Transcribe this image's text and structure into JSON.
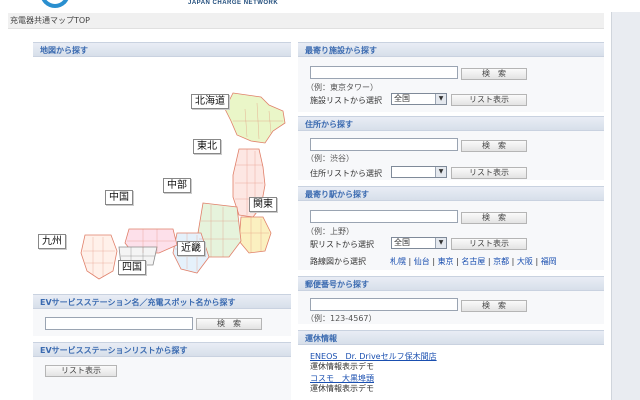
{
  "header": {
    "logo_text": "JAPAN CHARGE NETWORK",
    "breadcrumb": "充電器共通マップTOP"
  },
  "map_search": {
    "title": "地図から探す",
    "regions": [
      "北海道",
      "東北",
      "中部",
      "関東",
      "中国",
      "九州",
      "近畿",
      "四国"
    ]
  },
  "station_name_search": {
    "title": "EVサービスステーション名／充電スポット名から探す",
    "search_label": "検　索"
  },
  "station_list_search": {
    "title": "EVサービスステーションリストから探す",
    "list_label": "リスト表示"
  },
  "nearest_facility": {
    "title": "最寄り施設から探す",
    "search_label": "検　索",
    "example": "（例：東京タワー）",
    "list_select_label": "施設リストから選択",
    "select_value": "全国",
    "list_label": "リスト表示"
  },
  "address_search": {
    "title": "住所から探す",
    "search_label": "検　索",
    "example": "（例：渋谷）",
    "list_select_label": "住所リストから選択",
    "list_label": "リスト表示"
  },
  "nearest_station": {
    "title": "最寄り駅から探す",
    "search_label": "検　索",
    "example": "（例：上野）",
    "list_select_label": "駅リストから選択",
    "select_value": "全国",
    "list_label": "リスト表示",
    "route_map_label": "路線図から選択",
    "cities": [
      "札幌",
      "仙台",
      "東京",
      "名古屋",
      "京都",
      "大阪",
      "福岡"
    ]
  },
  "postal_search": {
    "title": "郵便番号から探す",
    "search_label": "検　索",
    "example": "（例：123-4567）"
  },
  "operation_info": {
    "title": "運休情報",
    "entries": [
      {
        "name": "ENEOS　Dr. Driveセルフ保木間店",
        "status": "運休情報表示デモ"
      },
      {
        "name": "コスモ　大黒埠頭",
        "status": "運休情報表示デモ"
      }
    ]
  },
  "colors": {
    "panel_header_text": "#3a6ab0",
    "link": "#1a4fb0",
    "logo_ring": "#2a8fcf"
  }
}
